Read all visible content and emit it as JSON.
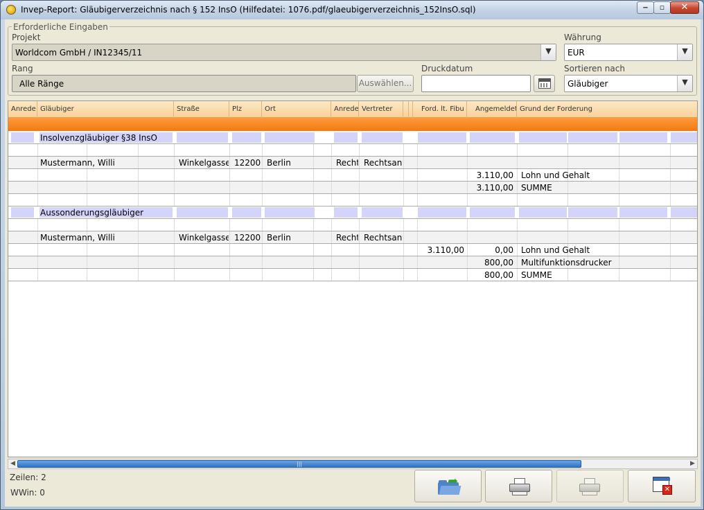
{
  "window": {
    "title": "Invep-Report: Gläubigerverzeichnis nach § 152 InsO   (Hilfedatei: 1076.pdf/glaeubigerverzeichnis_152InsO.sql)"
  },
  "form": {
    "legend": "Erforderliche Eingaben",
    "projekt_label": "Projekt",
    "projekt_value": "Worldcom GmbH / IN12345/11",
    "waehrung_label": "Währung",
    "waehrung_value": "EUR",
    "rang_label": "Rang",
    "rang_value": "Alle Ränge",
    "auswaehlen_label": "Auswählen...",
    "druckdatum_label": "Druckdatum",
    "druckdatum_value": "",
    "sortieren_label": "Sortieren nach",
    "sortieren_value": "Gläubiger"
  },
  "table": {
    "columns": [
      "Anrede",
      "Gläubiger",
      "Straße",
      "Plz",
      "Ort",
      "Anrede",
      "Vertreter",
      "Ford. lt. Fibu",
      "Angemeldet",
      "Grund der Forderung"
    ],
    "rows": [
      {
        "type": "group",
        "glaeubiger": "Insolvenzgläubiger §38 InsO"
      },
      {
        "type": "blank"
      },
      {
        "type": "data",
        "glaeubiger": "Mustermann, Willi",
        "strasse": "Winkelgasse",
        "plz": "12200",
        "ort": "Berlin",
        "anrede2": "Recht",
        "vertreter": "Rechtsanw",
        "ford": "",
        "angemeldet": "",
        "grund": ""
      },
      {
        "type": "data",
        "glaeubiger": "",
        "strasse": "",
        "plz": "",
        "ort": "",
        "anrede2": "",
        "vertreter": "",
        "ford": "",
        "angemeldet": "3.110,00",
        "grund": "Lohn und Gehalt"
      },
      {
        "type": "data",
        "glaeubiger": "",
        "strasse": "",
        "plz": "",
        "ort": "",
        "anrede2": "",
        "vertreter": "",
        "ford": "",
        "angemeldet": "3.110,00",
        "grund": "SUMME"
      },
      {
        "type": "blank"
      },
      {
        "type": "group",
        "glaeubiger": "Aussonderungsgläubiger"
      },
      {
        "type": "blank"
      },
      {
        "type": "data",
        "glaeubiger": "Mustermann, Willi",
        "strasse": "Winkelgasse",
        "plz": "12200",
        "ort": "Berlin",
        "anrede2": "Recht",
        "vertreter": "Rechtsanw",
        "ford": "",
        "angemeldet": "",
        "grund": ""
      },
      {
        "type": "data",
        "glaeubiger": "",
        "strasse": "",
        "plz": "",
        "ort": "",
        "anrede2": "",
        "vertreter": "",
        "ford": "3.110,00",
        "angemeldet": "0,00",
        "grund": "Lohn und Gehalt"
      },
      {
        "type": "data",
        "glaeubiger": "",
        "strasse": "",
        "plz": "",
        "ort": "",
        "anrede2": "",
        "vertreter": "",
        "ford": "",
        "angemeldet": "800,00",
        "grund": "Multifunktionsdrucker"
      },
      {
        "type": "data",
        "glaeubiger": "",
        "strasse": "",
        "plz": "",
        "ort": "",
        "anrede2": "",
        "vertreter": "",
        "ford": "",
        "angemeldet": "800,00",
        "grund": "SUMME"
      }
    ]
  },
  "status": {
    "zeilen": "Zeilen: 2",
    "wwin": "WWin: 0"
  },
  "icons": {
    "open": "folder-export-icon",
    "print": "printer-icon",
    "print_disabled": "printer-preview-icon",
    "close": "close-window-icon"
  },
  "colors": {
    "header_bg": "#f9d29a",
    "orange_bar": "#f27a10",
    "group_fill": "#d4d4fa",
    "scroll_thumb": "#2e74c6"
  }
}
